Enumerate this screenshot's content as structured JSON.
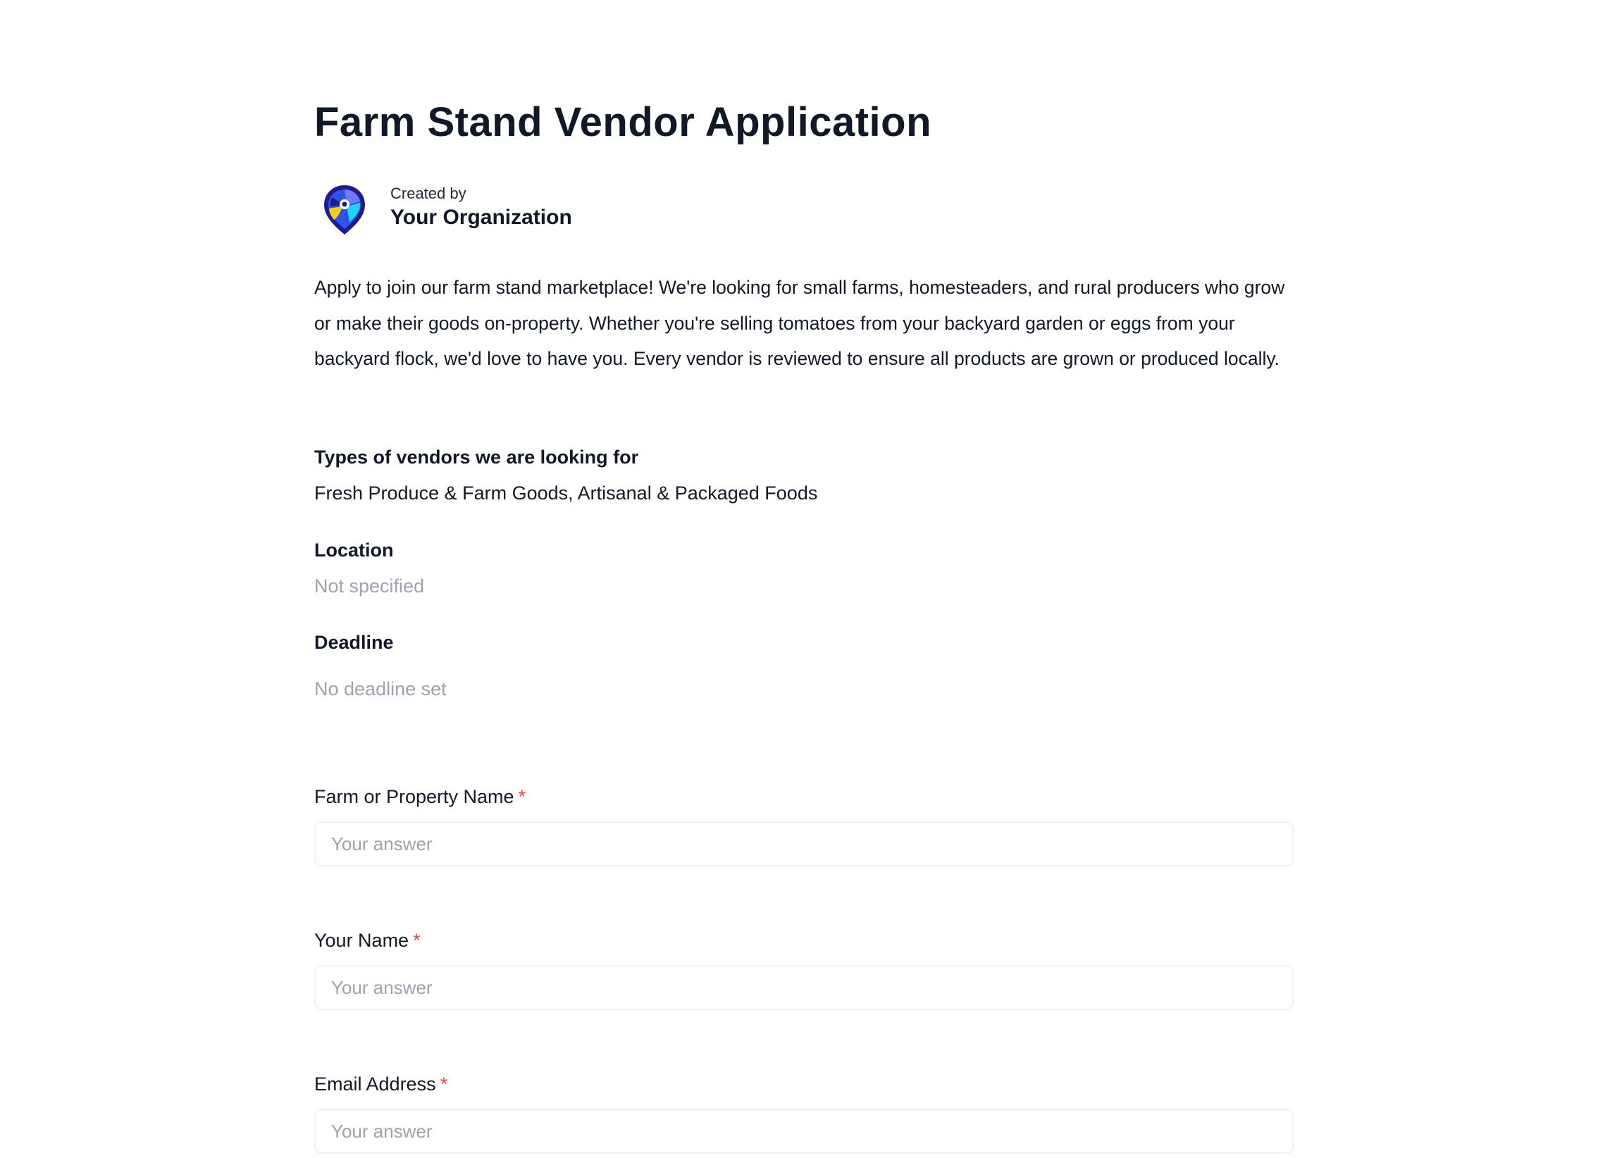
{
  "form": {
    "title": "Farm Stand Vendor Application",
    "creator": {
      "created_by_label": "Created by",
      "organization": "Your Organization",
      "logo_icon": "map-pin-logo-icon"
    },
    "description": "Apply to join our farm stand marketplace! We're looking for small farms, homesteaders, and rural producers who grow or make their goods on-property. Whether you're selling tomatoes from your backyard garden or eggs from your backyard flock, we'd love to have you. Every vendor is reviewed to ensure all products are grown or produced locally.",
    "info": {
      "vendor_types_label": "Types of vendors we are looking for",
      "vendor_types_value": "Fresh Produce & Farm Goods, Artisanal & Packaged Foods",
      "location_label": "Location",
      "location_value": "Not specified",
      "deadline_label": "Deadline",
      "deadline_value": "No deadline set"
    },
    "fields": [
      {
        "label": "Farm or Property Name",
        "required_mark": "*",
        "placeholder": "Your answer",
        "value": ""
      },
      {
        "label": "Your Name",
        "required_mark": "*",
        "placeholder": "Your answer",
        "value": ""
      },
      {
        "label": "Email Address",
        "required_mark": "*",
        "placeholder": "Your answer",
        "value": ""
      }
    ]
  },
  "colors": {
    "text_primary": "#111827",
    "text_muted": "#9ca3af",
    "required": "#ef4444",
    "input_border": "#f1f2f4",
    "logo_navy": "#1e1b8a",
    "logo_blue": "#2f54eb",
    "logo_cyan": "#22d3ee",
    "logo_yellow": "#facc15"
  }
}
